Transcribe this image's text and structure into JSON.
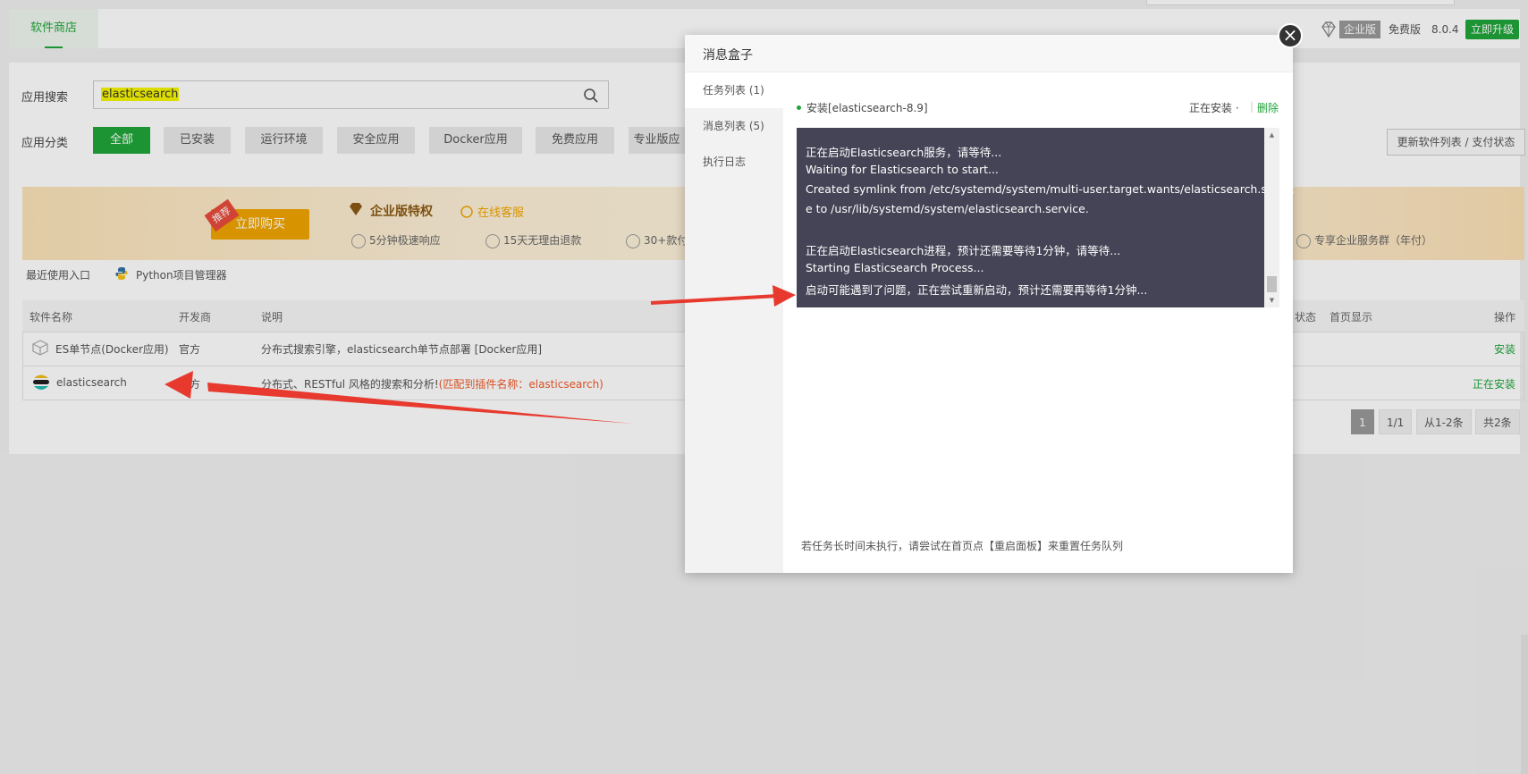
{
  "header": {
    "tab_store": "软件商店",
    "badge_enterprise": "企业版",
    "free_version": "免费版",
    "version": "8.0.4",
    "upgrade": "立即升级"
  },
  "search": {
    "label": "应用搜索",
    "value": "elasticsearch"
  },
  "category": {
    "label": "应用分类",
    "items": [
      "全部",
      "已安装",
      "运行环境",
      "安全应用",
      "Docker应用",
      "免费应用",
      "专业版应"
    ]
  },
  "refresh_button": "更新软件列表 / 支付状态",
  "banner": {
    "recommend_tag": "推荐",
    "buy_now": "立即购买",
    "enterprise_title": "企业版特权",
    "online_service": "在线客服",
    "features": [
      "5分钟极速响应",
      "15天无理由退款",
      "30+款付",
      "专享企业服务群（年付）"
    ]
  },
  "recent": {
    "label": "最近使用入口",
    "entry": "Python项目管理器"
  },
  "table": {
    "headers": [
      "软件名称",
      "开发商",
      "说明",
      "状态",
      "首页显示",
      "操作"
    ],
    "rows": [
      {
        "name": "ES单节点(Docker应用)",
        "vendor": "官方",
        "desc": "分布式搜索引擎，elasticsearch单节点部署 [Docker应用]",
        "action": "安装"
      },
      {
        "name": "elasticsearch",
        "vendor": "官方",
        "desc": "分布式、RESTful 风格的搜索和分析!",
        "desc_match": "(匹配到插件名称：elasticsearch)",
        "action": "正在安装"
      }
    ]
  },
  "pagination": {
    "current": "1",
    "pages": "1/1",
    "range": "从1-2条",
    "total": "共2条"
  },
  "modal": {
    "title": "消息盒子",
    "close": "×",
    "side_items": [
      "任务列表 (1)",
      "消息列表 (5)",
      "执行日志"
    ],
    "task": {
      "name": "安装[elasticsearch-8.9]",
      "status": "正在安装 ·",
      "separator": "|",
      "delete": "删除"
    },
    "console_lines": [
      "正在启动Elasticsearch服务，请等待...",
      "Waiting for Elasticsearch to start...",
      "Created symlink from /etc/systemd/system/multi-user.target.wants/elasticsearch.servic",
      "e to /usr/lib/systemd/system/elasticsearch.service.",
      "",
      "正在启动Elasticsearch进程，预计还需要等待1分钟，请等待...",
      "Starting Elasticsearch Process...",
      "启动可能遇到了问题，正在尝试重新启动，预计还需要再等待1分钟..."
    ],
    "tip": "若任务长时间未执行，请尝试在首页点【重启面板】来重置任务队列"
  },
  "colors": {
    "accent": "#20a53a",
    "arrow": "#e8392e",
    "console_bg": "#444456",
    "match_text": "#f05a28"
  }
}
